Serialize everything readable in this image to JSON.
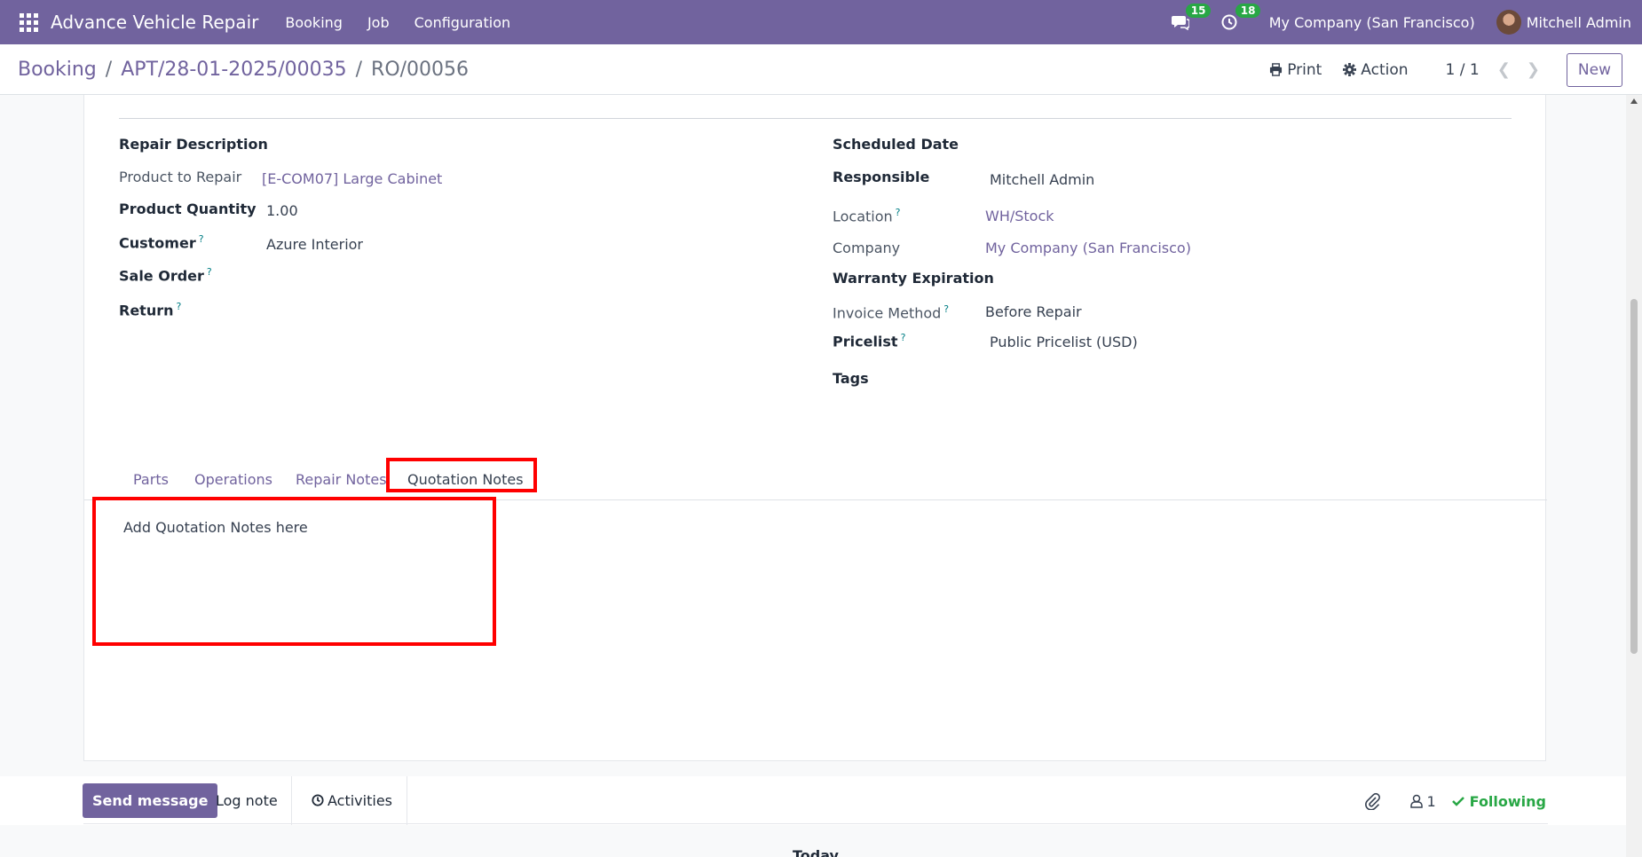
{
  "navbar": {
    "app_title": "Advance Vehicle Repair",
    "menu": [
      "Booking",
      "Job",
      "Configuration"
    ],
    "messages_count": "15",
    "activities_count": "18",
    "company": "My Company (San Francisco)",
    "user": "Mitchell Admin"
  },
  "breadcrumb": {
    "root": "Booking",
    "parent": "APT/28-01-2025/00035",
    "current": "RO/00056",
    "separator": "/"
  },
  "control": {
    "print": "Print",
    "action": "Action",
    "pager": "1 / 1",
    "new": "New"
  },
  "left": {
    "section": "Repair Description",
    "product_label": "Product to Repair",
    "product_value": "[E-COM07] Large Cabinet",
    "qty_label": "Product Quantity",
    "qty_value": "1.00",
    "customer_label": "Customer",
    "customer_value": "Azure Interior",
    "sale_order_label": "Sale Order",
    "return_label": "Return"
  },
  "right": {
    "scheduled_label": "Scheduled Date",
    "responsible_label": "Responsible",
    "responsible_value": "Mitchell Admin",
    "location_label": "Location",
    "location_value": "WH/Stock",
    "company_label": "Company",
    "company_value": "My Company (San Francisco)",
    "warranty_label": "Warranty Expiration",
    "invoice_label": "Invoice Method",
    "invoice_value": "Before Repair",
    "pricelist_label": "Pricelist",
    "pricelist_value": "Public Pricelist (USD)",
    "tags_label": "Tags"
  },
  "help_mark": "?",
  "tabs": [
    "Parts",
    "Operations",
    "Repair Notes",
    "Quotation Notes"
  ],
  "active_tab": "Quotation Notes",
  "notes_placeholder": "Add Quotation Notes here",
  "chatter": {
    "send": "Send message",
    "log": "Log note",
    "activities": "Activities",
    "followers": "1",
    "following": "Following",
    "today": "Today"
  },
  "colors": {
    "brand": "#71639e",
    "highlight": "#ff0000",
    "success": "#28a745"
  }
}
